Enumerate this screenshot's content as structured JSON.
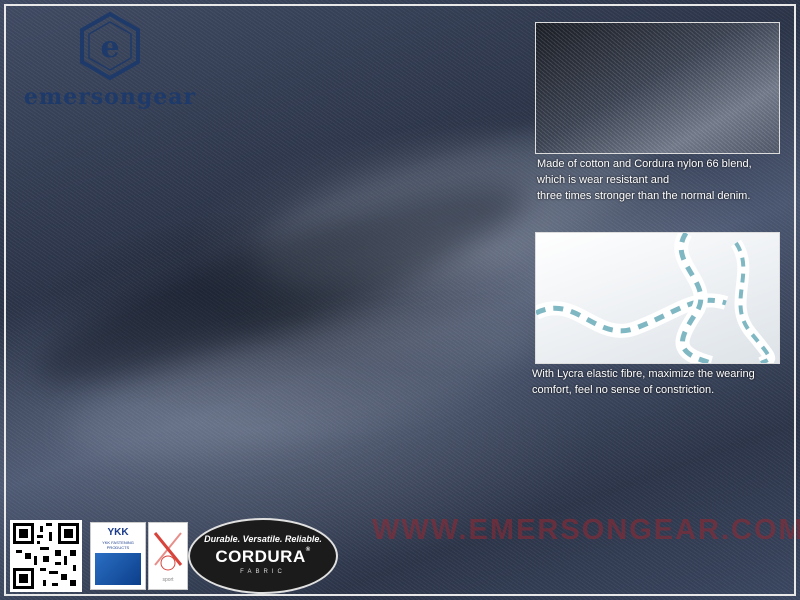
{
  "brand": {
    "logo_text": "emersongear",
    "logo_mark_letter": "e"
  },
  "features": [
    {
      "caption_lines": [
        "Made of cotton and Cordura nylon 66 blend,",
        "which is wear resistant and",
        "three times stronger than the normal denim."
      ]
    },
    {
      "caption_lines": [
        "With Lycra elastic fibre, maximize the wearing",
        "comfort, feel no sense of constriction."
      ]
    }
  ],
  "watermark": "WWW.EMERSONGEAR.COM",
  "badges": {
    "ykk_title": "YKK",
    "ykk_sub": "YKK FASTENING PRODUCTS",
    "lycra_sub": "sport",
    "cordura_tagline": "Durable. Versatile. Reliable.",
    "cordura_name": "CORDURA",
    "cordura_mark": "®",
    "cordura_fabric": "FABRIC"
  },
  "colors": {
    "denim": "#2f3a50",
    "logo": "#1e3a6a",
    "watermark": "#962832",
    "lycra_helix": "#7fb7c3"
  },
  "icons": [
    "qr-code-icon",
    "ykk-badge-icon",
    "lycra-badge-icon",
    "cordura-badge-icon",
    "emersongear-logo-icon"
  ]
}
